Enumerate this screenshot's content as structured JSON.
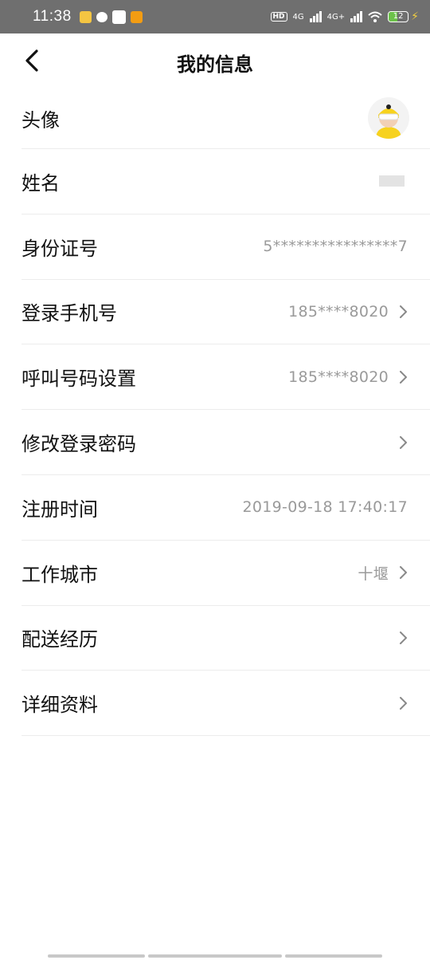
{
  "status_bar": {
    "time": "11:38",
    "network_1": "4G",
    "network_2": "4G+",
    "hd_label": "HD",
    "battery": "12"
  },
  "header": {
    "title": "我的信息"
  },
  "rows": [
    {
      "label": "头像",
      "value": "",
      "type": "avatar",
      "chevron": false
    },
    {
      "label": "姓名",
      "value": "",
      "type": "masked",
      "chevron": false
    },
    {
      "label": "身份证号",
      "value": "5****************7",
      "type": "text",
      "chevron": false
    },
    {
      "label": "登录手机号",
      "value": "185****8020",
      "type": "text",
      "chevron": true
    },
    {
      "label": "呼叫号码设置",
      "value": "185****8020",
      "type": "text",
      "chevron": true
    },
    {
      "label": "修改登录密码",
      "value": "",
      "type": "text",
      "chevron": true
    },
    {
      "label": "注册时间",
      "value": "2019-09-18 17:40:17",
      "type": "text",
      "chevron": false
    },
    {
      "label": "工作城市",
      "value": "十堰",
      "type": "text",
      "chevron": true
    },
    {
      "label": "配送经历",
      "value": "",
      "type": "text",
      "chevron": true
    },
    {
      "label": "详细资料",
      "value": "",
      "type": "text",
      "chevron": true
    }
  ],
  "colors": {
    "status_bar_bg": "#6f6f6f",
    "value_text": "#9a9a9a",
    "divider": "#ececec",
    "avatar_accent": "#f7d21e"
  }
}
